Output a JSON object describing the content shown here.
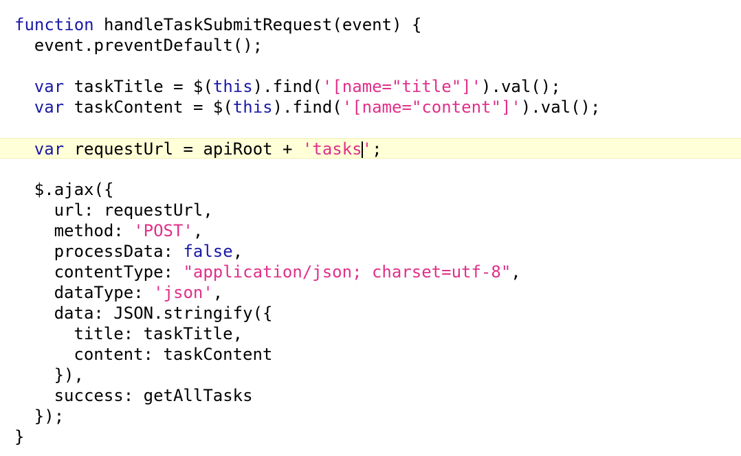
{
  "colors": {
    "keyword": "#1a1aa6",
    "string": "#e0308a",
    "plain": "#000000",
    "current_line_bg": "#ffffd8",
    "background": "#ffffff"
  },
  "editor": {
    "current_line": 6,
    "caret": {
      "line": 6,
      "after_token": 5
    },
    "lines": [
      {
        "indent": 0,
        "tokens": [
          {
            "t": "function",
            "c": "kw"
          },
          {
            "t": " handleTaskSubmitRequest(event) {",
            "c": "plain"
          }
        ]
      },
      {
        "indent": 1,
        "tokens": [
          {
            "t": "event.preventDefault();",
            "c": "plain"
          }
        ]
      },
      {
        "indent": 0,
        "tokens": []
      },
      {
        "indent": 1,
        "tokens": [
          {
            "t": "var",
            "c": "kw"
          },
          {
            "t": " taskTitle = $(",
            "c": "plain"
          },
          {
            "t": "this",
            "c": "kw"
          },
          {
            "t": ").find(",
            "c": "plain"
          },
          {
            "t": "'[name=\"title\"]'",
            "c": "str"
          },
          {
            "t": ").val();",
            "c": "plain"
          }
        ]
      },
      {
        "indent": 1,
        "tokens": [
          {
            "t": "var",
            "c": "kw"
          },
          {
            "t": " taskContent = $(",
            "c": "plain"
          },
          {
            "t": "this",
            "c": "kw"
          },
          {
            "t": ").find(",
            "c": "plain"
          },
          {
            "t": "'[name=\"content\"]'",
            "c": "str"
          },
          {
            "t": ").val();",
            "c": "plain"
          }
        ]
      },
      {
        "indent": 0,
        "tokens": []
      },
      {
        "indent": 1,
        "tokens": [
          {
            "t": "var",
            "c": "kw"
          },
          {
            "t": " requestUrl = apiRoot + ",
            "c": "plain"
          },
          {
            "t": "'tasks",
            "c": "str"
          },
          {
            "t": "'",
            "c": "str"
          },
          {
            "t": ";",
            "c": "plain"
          }
        ]
      },
      {
        "indent": 0,
        "tokens": []
      },
      {
        "indent": 1,
        "tokens": [
          {
            "t": "$.ajax({",
            "c": "plain"
          }
        ]
      },
      {
        "indent": 2,
        "tokens": [
          {
            "t": "url: requestUrl,",
            "c": "plain"
          }
        ]
      },
      {
        "indent": 2,
        "tokens": [
          {
            "t": "method: ",
            "c": "plain"
          },
          {
            "t": "'POST'",
            "c": "str"
          },
          {
            "t": ",",
            "c": "plain"
          }
        ]
      },
      {
        "indent": 2,
        "tokens": [
          {
            "t": "processData: ",
            "c": "plain"
          },
          {
            "t": "false",
            "c": "kw"
          },
          {
            "t": ",",
            "c": "plain"
          }
        ]
      },
      {
        "indent": 2,
        "tokens": [
          {
            "t": "contentType: ",
            "c": "plain"
          },
          {
            "t": "\"application/json; charset=utf-8\"",
            "c": "str"
          },
          {
            "t": ",",
            "c": "plain"
          }
        ]
      },
      {
        "indent": 2,
        "tokens": [
          {
            "t": "dataType: ",
            "c": "plain"
          },
          {
            "t": "'json'",
            "c": "str"
          },
          {
            "t": ",",
            "c": "plain"
          }
        ]
      },
      {
        "indent": 2,
        "tokens": [
          {
            "t": "data: JSON.stringify({",
            "c": "plain"
          }
        ]
      },
      {
        "indent": 3,
        "tokens": [
          {
            "t": "title: taskTitle,",
            "c": "plain"
          }
        ]
      },
      {
        "indent": 3,
        "tokens": [
          {
            "t": "content: taskContent",
            "c": "plain"
          }
        ]
      },
      {
        "indent": 2,
        "tokens": [
          {
            "t": "}),",
            "c": "plain"
          }
        ]
      },
      {
        "indent": 2,
        "tokens": [
          {
            "t": "success: getAllTasks",
            "c": "plain"
          }
        ]
      },
      {
        "indent": 1,
        "tokens": [
          {
            "t": "});",
            "c": "plain"
          }
        ]
      },
      {
        "indent": 0,
        "tokens": [
          {
            "t": "}",
            "c": "plain"
          }
        ]
      }
    ]
  }
}
